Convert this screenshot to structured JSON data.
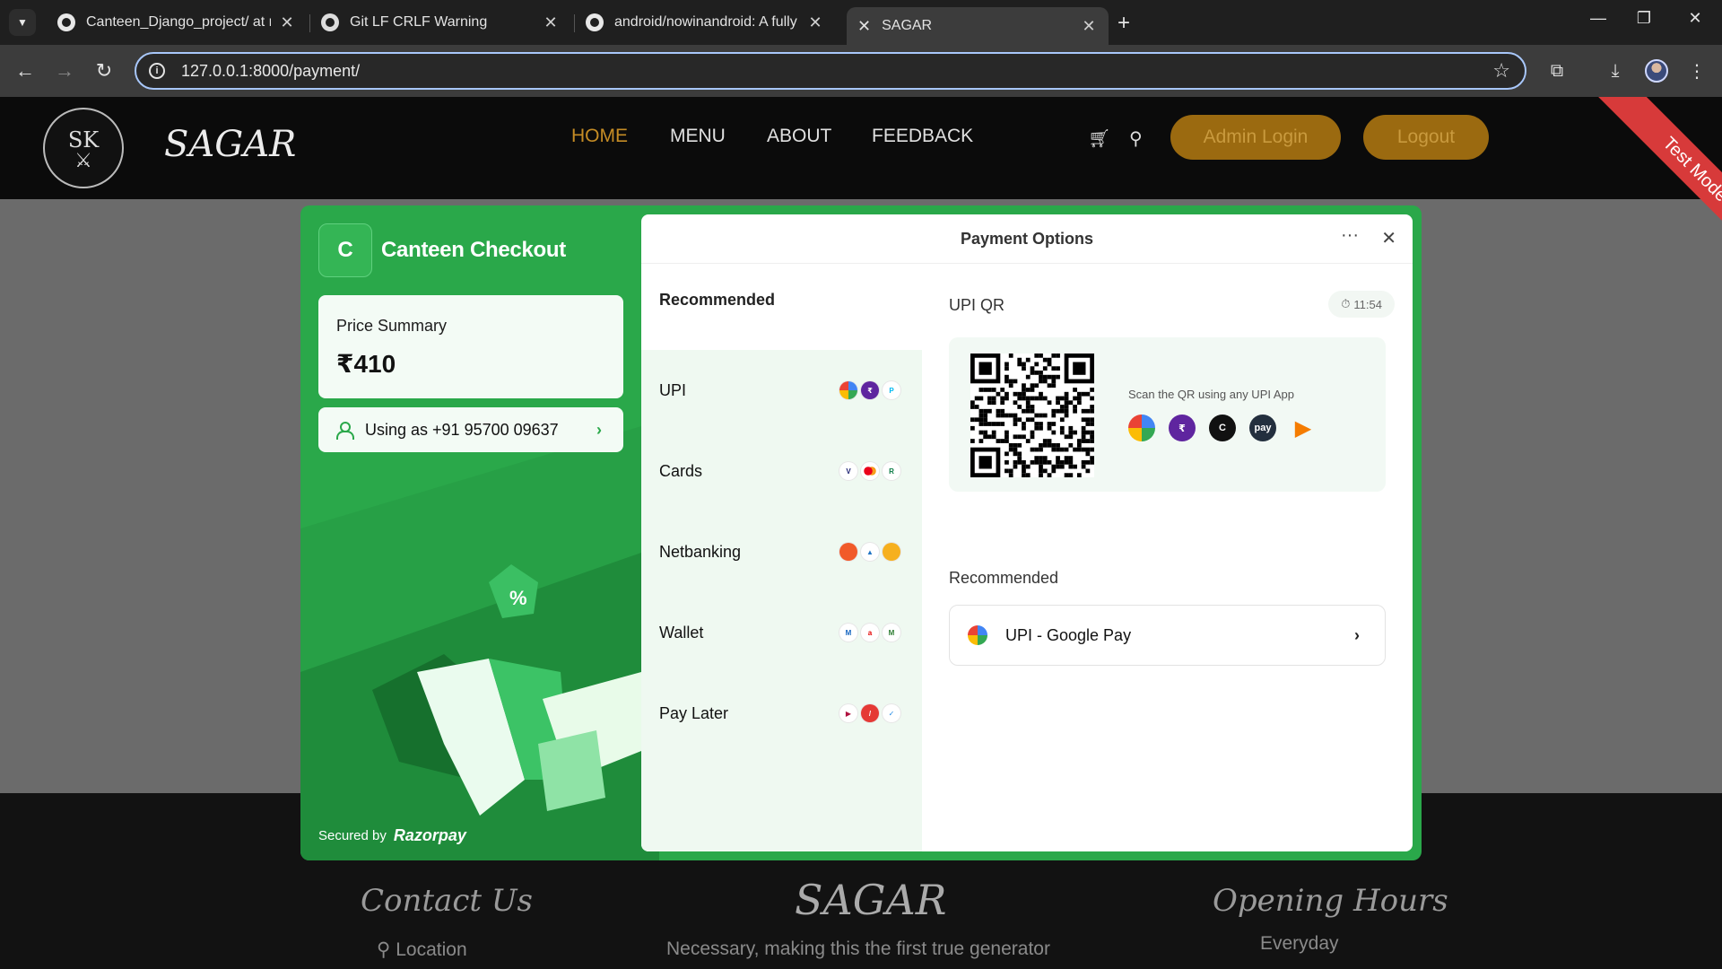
{
  "browser": {
    "tabs": [
      {
        "title": "Canteen_Django_project/ at ma",
        "icon": "github-icon"
      },
      {
        "title": "Git LF CRLF Warning",
        "icon": "chatgpt-icon"
      },
      {
        "title": "android/nowinandroid: A fully f",
        "icon": "github-icon"
      },
      {
        "title": "SAGAR",
        "icon": "sagar-favicon",
        "active": true
      }
    ],
    "url": "127.0.0.1:8000/payment/"
  },
  "site": {
    "logo_text": "SK",
    "brand": "SAGAR",
    "nav": [
      "HOME",
      "MENU",
      "ABOUT",
      "FEEDBACK"
    ],
    "admin_login": "Admin Login",
    "logout": "Logout",
    "ribbon": "Test Mode",
    "footer": {
      "contact_title": "Contact Us",
      "brand": "SAGAR",
      "hours_title": "Opening Hours",
      "location": "Location",
      "tagline": "Necessary, making this the first true generator",
      "everyday": "Everyday"
    },
    "accent_color": "#c58c25"
  },
  "checkout": {
    "merchant_initial": "C",
    "merchant_name": "Canteen Checkout",
    "price_label": "Price Summary",
    "price_value": "₹410",
    "user_text": "Using as +91 95700 09637",
    "secured_by": "Secured by",
    "provider": "Razorpay",
    "theme_color": "#2aa84a",
    "panel_title": "Payment Options",
    "methods_heading": "Recommended",
    "methods": [
      {
        "label": "UPI",
        "logos": [
          "gpay",
          "phonepe",
          "paytm"
        ]
      },
      {
        "label": "Cards",
        "logos": [
          "visa",
          "mastercard",
          "rupay"
        ]
      },
      {
        "label": "Netbanking",
        "logos": [
          "bank-1",
          "bank-2",
          "bank-3"
        ]
      },
      {
        "label": "Wallet",
        "logos": [
          "mobikwik",
          "airtel",
          "m-wallet"
        ]
      },
      {
        "label": "Pay Later",
        "logos": [
          "later-1",
          "later-2",
          "later-3"
        ]
      }
    ],
    "qr_title": "UPI QR",
    "qr_timer": "11:54",
    "qr_hint": "Scan the QR using any UPI App",
    "qr_apps": [
      "gpay",
      "phonepe",
      "cred",
      "amazon-pay",
      "bhim"
    ],
    "recommended_title": "Recommended",
    "recommended_item": "UPI - Google Pay"
  }
}
